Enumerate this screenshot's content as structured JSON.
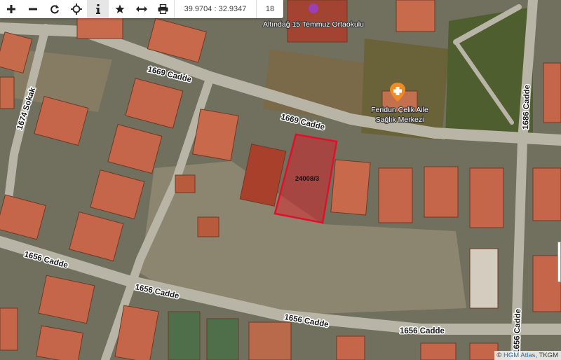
{
  "toolbar": {
    "buttons": [
      {
        "name": "zoom-in-button",
        "icon": "plus-icon"
      },
      {
        "name": "zoom-out-button",
        "icon": "minus-icon"
      },
      {
        "name": "refresh-button",
        "icon": "refresh-icon"
      },
      {
        "name": "locate-button",
        "icon": "crosshair-icon"
      },
      {
        "name": "info-button",
        "icon": "info-icon",
        "active": true
      },
      {
        "name": "favorite-button",
        "icon": "star-icon"
      },
      {
        "name": "measure-button",
        "icon": "arrows-horizontal-icon"
      },
      {
        "name": "print-button",
        "icon": "printer-icon"
      }
    ],
    "coordinates": "39.9704 : 32.9347",
    "zoom_level": "18"
  },
  "map": {
    "roads": [
      {
        "id": "road-1669-upper",
        "label": "1669 Cadde"
      },
      {
        "id": "road-1669-mid",
        "label": "1669 Cadde"
      },
      {
        "id": "road-1674",
        "label": "1674 Sokak"
      },
      {
        "id": "road-1686",
        "label": "1686 Cadde"
      },
      {
        "id": "road-1656-west",
        "label": "1656 Cadde"
      },
      {
        "id": "road-1656-center",
        "label": "1656 Cadde"
      },
      {
        "id": "road-1656-mid",
        "label": "1656 Cadde"
      },
      {
        "id": "road-1656-east",
        "label": "1656 Cadde"
      },
      {
        "id": "road-1656-vert",
        "label": "1656 Cadde"
      }
    ],
    "pois": [
      {
        "id": "school",
        "label": "Altındağ 15 Temmuz Ortaokulu",
        "marker_color": "#9b3fb5"
      },
      {
        "id": "health-center",
        "label_line1": "Feridun Çelik Aile",
        "label_line2": "Sağlık Merkezi",
        "marker_color": "#f08a24"
      }
    ],
    "parcel": {
      "label": "24008/3",
      "outline_color": "#e0102a"
    }
  },
  "attribution": {
    "symbol": "©",
    "link_text": "HGM Atlas",
    "separator": ",",
    "provider": "TKGM"
  }
}
